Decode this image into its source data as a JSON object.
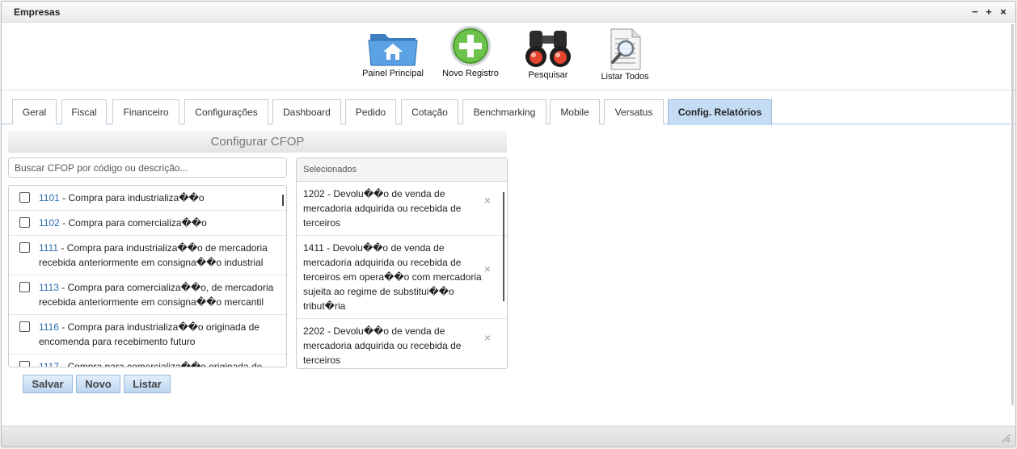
{
  "window": {
    "title": "Empresas"
  },
  "controls": {
    "minimize": "−",
    "maximize": "+",
    "close": "×"
  },
  "toolbar": [
    {
      "label": "Painel Principal",
      "icon": "home-folder-icon"
    },
    {
      "label": "Novo Registro",
      "icon": "add-plus-icon"
    },
    {
      "label": "Pesquisar",
      "icon": "binoculars-icon"
    },
    {
      "label": "Listar Todos",
      "icon": "document-magnifier-icon"
    }
  ],
  "tabs": [
    {
      "label": "Geral"
    },
    {
      "label": "Fiscal"
    },
    {
      "label": "Financeiro"
    },
    {
      "label": "Configurações"
    },
    {
      "label": "Dashboard"
    },
    {
      "label": "Pedido"
    },
    {
      "label": "Cotação"
    },
    {
      "label": "Benchmarking"
    },
    {
      "label": "Mobile"
    },
    {
      "label": "Versatus"
    },
    {
      "label": "Config. Relatórios",
      "active": true
    }
  ],
  "cfop": {
    "title": "Configurar CFOP",
    "search_placeholder": "Buscar CFOP por código ou descrição...",
    "items": [
      {
        "code": "1101",
        "desc": " - Compra para industrializa��o",
        "checked": false
      },
      {
        "code": "1102",
        "desc": " - Compra para comercializa��o",
        "checked": false
      },
      {
        "code": "1111",
        "desc": " - Compra para industrializa��o de mercadoria recebida anteriormente em consigna��o industrial",
        "checked": false
      },
      {
        "code": "1113",
        "desc": " - Compra para comercializa��o, de mercadoria recebida anteriormente em consigna��o mercantil",
        "checked": false
      },
      {
        "code": "1116",
        "desc": " - Compra para industrializa��o originada de encomenda para recebimento futuro",
        "checked": false
      },
      {
        "code": "1117",
        "desc": " - Compra para comercializa��o originada de",
        "checked": false
      }
    ]
  },
  "selected": {
    "header": "Selecionados",
    "remove_symbol": "×",
    "items": [
      {
        "text": "1202 - Devolu��o de venda de mercadoria adquirida ou recebida de terceiros"
      },
      {
        "text": "1411 - Devolu��o de venda de mercadoria adquirida ou recebida de terceiros em opera��o com mercadoria sujeita ao regime de substitui��o tribut�ria"
      },
      {
        "text": "2202 - Devolu��o de venda de mercadoria adquirida ou recebida de terceiros"
      }
    ]
  },
  "buttons": {
    "save": "Salvar",
    "new": "Novo",
    "list": "Listar"
  }
}
